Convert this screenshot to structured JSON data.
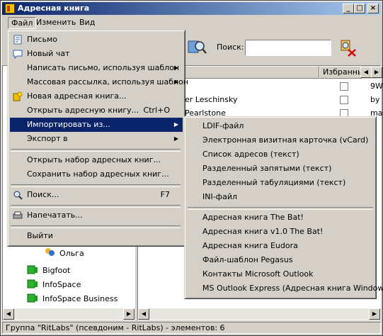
{
  "window": {
    "title": "Адресная книга"
  },
  "caption_buttons": {
    "minimize": "_",
    "maximize": "□",
    "close": "×"
  },
  "menubar": [
    {
      "label": "Файл",
      "active": true
    },
    {
      "label": "Изменить",
      "active": false
    },
    {
      "label": "Вид",
      "active": false
    }
  ],
  "toolbar": {
    "search_label": "Поиск:",
    "search_value": ""
  },
  "list": {
    "header_col2": "Избранны",
    "rows": [
      {
        "name": "",
        "extra": "9W"
      },
      {
        "name": "er Leschinsky",
        "extra": "by"
      },
      {
        "name": "Pearlstone",
        "extra": "ma"
      }
    ]
  },
  "tree": [
    {
      "label": "Ольга"
    },
    {
      "label": "Bigfoot"
    },
    {
      "label": "InfoSpace"
    },
    {
      "label": "InfoSpace Business"
    }
  ],
  "file_menu": [
    {
      "label": "Письмо",
      "icon": "letter-icon"
    },
    {
      "label": "Новый чат",
      "icon": "chat-icon"
    },
    {
      "label": "Написать письмо, используя шаблон",
      "submenu": true
    },
    {
      "label": "Массовая рассылка, используя шаблон",
      "submenu": true
    },
    {
      "label": "Новая адресная книга...",
      "icon": "new-book-icon"
    },
    {
      "label": "Открыть адресную книгу...",
      "shortcut": "Ctrl+O"
    },
    {
      "label": "Импортировать из...",
      "submenu": true,
      "highlight": true
    },
    {
      "label": "Экспорт в",
      "submenu": true
    },
    {
      "label": "Открыть набор адресных книг..."
    },
    {
      "label": "Сохранить набор адресных книг..."
    },
    {
      "label": "Поиск...",
      "shortcut": "F7",
      "icon": "search-icon"
    },
    {
      "label": "Напечатать...",
      "icon": "print-icon"
    },
    {
      "label": "Выйти"
    }
  ],
  "import_submenu": [
    "LDIF-файл",
    "Электронная визитная карточка (vCard)",
    "Список адресов (текст)",
    "Разделенный запятыми (текст)",
    "Разделенный табуляциями (текст)",
    "INI-файл",
    "Адресная книга The Bat!",
    "Адресная книга v1.0 The Bat!",
    "Адресная книга Eudora",
    "Файл-шаблон Pegasus",
    "Контакты Microsoft Outlook",
    "MS Outlook Express (Адресная книга Windows)"
  ],
  "statusbar": {
    "text": "Группа \"RitLabs\" (псевдоним - RitLabs) - элементов: 6"
  },
  "colors": {
    "highlight": "#0a246a",
    "title_start": "#0a246a",
    "title_end": "#a6caf0",
    "face": "#d4d0c8"
  }
}
